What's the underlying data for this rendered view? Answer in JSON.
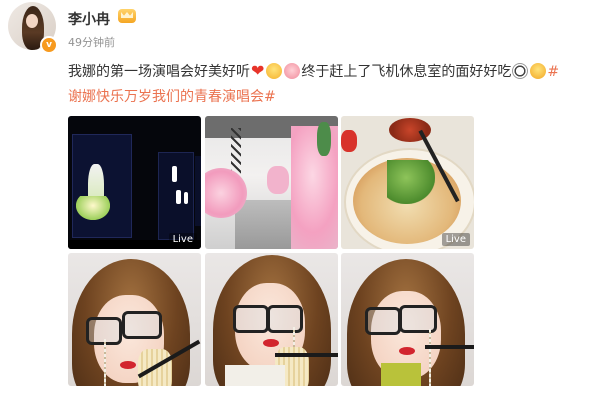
{
  "post": {
    "user_name": "李小冉",
    "verified_mark": "v",
    "timestamp": "49分钟前",
    "text_part1": "我娜的第一场演唱会好美好听",
    "text_part2": "终于赶上了飞机休息室的面好好吃",
    "topic": "#谢娜快乐万岁我们的青春演唱会#",
    "topic_line1": "#",
    "topic_line2": "谢娜快乐万岁我们的青春演唱会#",
    "heart_glyph": "❤",
    "emoji_icons": [
      "heart-icon",
      "yellow-emoji-icon",
      "pink-emoji-icon",
      "panda-emoji-icon",
      "laughing-emoji-icon"
    ]
  },
  "photos": [
    {
      "id": "photo-1",
      "live_label": "Live"
    },
    {
      "id": "photo-2"
    },
    {
      "id": "photo-3",
      "live_label": "Live"
    },
    {
      "id": "photo-4"
    },
    {
      "id": "photo-5"
    },
    {
      "id": "photo-6"
    }
  ],
  "colors": {
    "topic": "#eb7350",
    "timestamp": "#939393",
    "verified_badge": "#f79a1f"
  }
}
